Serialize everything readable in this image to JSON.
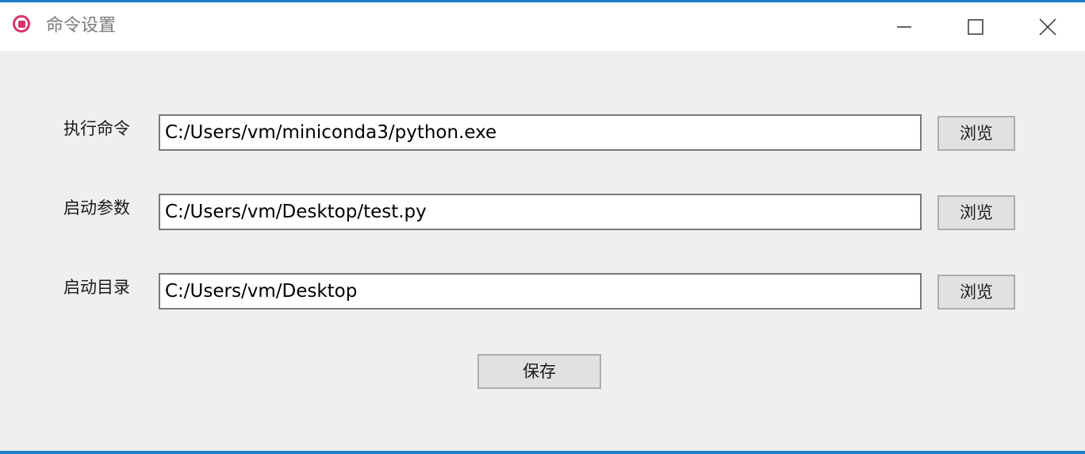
{
  "window": {
    "title": "命令设置",
    "accent_color": "#1b7ccb",
    "icon": "record-stop-icon",
    "icon_color": "#d6336c",
    "controls": [
      "minimize-icon",
      "maximize-icon",
      "close-icon"
    ]
  },
  "form": {
    "rows": [
      {
        "label": "执行命令",
        "value": "C:/Users/vm/miniconda3/python.exe",
        "browse_label": "浏览"
      },
      {
        "label": "启动参数",
        "value": "C:/Users/vm/Desktop/test.py",
        "browse_label": "浏览"
      },
      {
        "label": "启动目录",
        "value": "C:/Users/vm/Desktop",
        "browse_label": "浏览"
      }
    ],
    "save_label": "保存"
  }
}
